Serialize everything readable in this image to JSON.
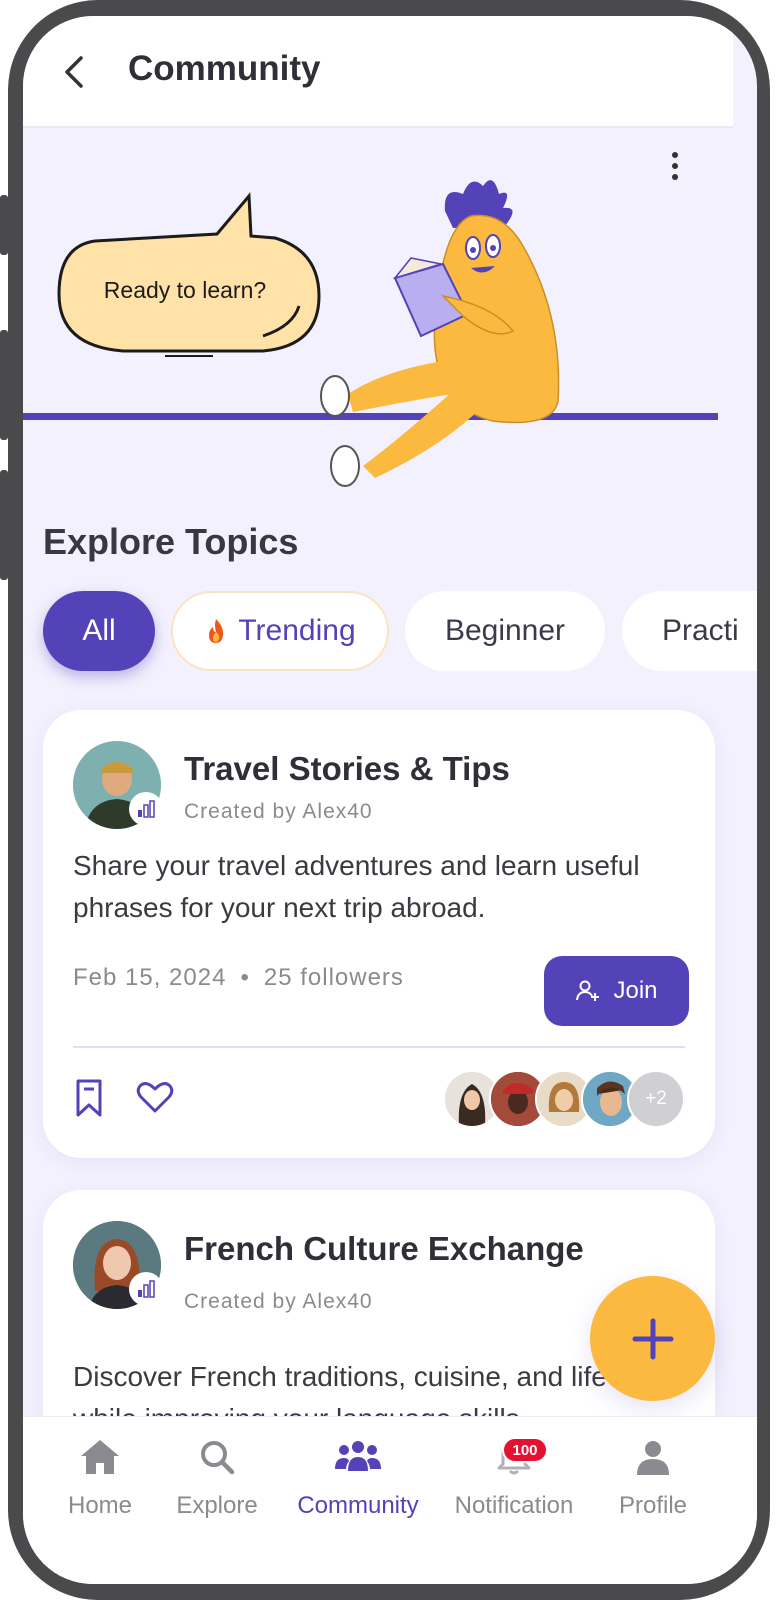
{
  "header": {
    "title": "Community"
  },
  "hero": {
    "speech_text": "Ready to learn?"
  },
  "topics": {
    "title": "Explore Topics",
    "chips": [
      {
        "label": "All",
        "active": true
      },
      {
        "label": "Trending",
        "icon": "fire-icon"
      },
      {
        "label": "Beginner"
      },
      {
        "label": "Practi"
      }
    ]
  },
  "cards": [
    {
      "title": "Travel Stories & Tips",
      "creator": "Created by Alex40",
      "description": "Share your travel adventures and learn useful phrases for your next trip abroad.",
      "date": "Feb 15, 2024",
      "followers": "25 followers",
      "join_label": "Join",
      "more_members": "+2"
    },
    {
      "title": "French Culture Exchange",
      "creator": "Created by Alex40",
      "description": "Discover French traditions, cuisine, and life while improving your language skills."
    }
  ],
  "fab": {
    "icon": "plus-icon"
  },
  "nav": {
    "items": [
      {
        "label": "Home",
        "icon": "home-icon"
      },
      {
        "label": "Explore",
        "icon": "search-icon"
      },
      {
        "label": "Community",
        "icon": "community-icon",
        "active": true
      },
      {
        "label": "Notification",
        "icon": "bell-icon",
        "badge": "100"
      },
      {
        "label": "Profile",
        "icon": "profile-icon"
      }
    ]
  },
  "colors": {
    "primary": "#5442b8",
    "accent": "#fbb93f",
    "background": "#f3f1fd",
    "badge": "#e8102f"
  }
}
